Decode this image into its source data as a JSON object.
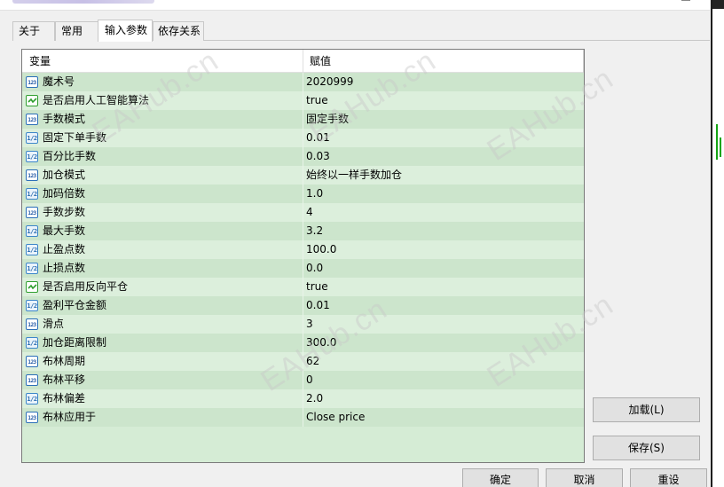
{
  "tabs": [
    {
      "label": "关于",
      "active": false
    },
    {
      "label": "常用",
      "active": false
    },
    {
      "label": "输入参数",
      "active": true
    },
    {
      "label": "依存关系",
      "active": false
    }
  ],
  "grid": {
    "headers": {
      "variable": "变量",
      "value": "赋值"
    },
    "rows": [
      {
        "type": "int",
        "name": "魔术号",
        "value": "2020999"
      },
      {
        "type": "bool",
        "name": "是否启用人工智能算法",
        "value": "true"
      },
      {
        "type": "int",
        "name": "手数模式",
        "value": "固定手数"
      },
      {
        "type": "double",
        "name": "固定下单手数",
        "value": "0.01"
      },
      {
        "type": "double",
        "name": "百分比手数",
        "value": "0.03"
      },
      {
        "type": "int",
        "name": "加仓模式",
        "value": "始终以一样手数加仓"
      },
      {
        "type": "double",
        "name": "加码倍数",
        "value": "1.0"
      },
      {
        "type": "int",
        "name": "手数步数",
        "value": "4"
      },
      {
        "type": "double",
        "name": "最大手数",
        "value": "3.2"
      },
      {
        "type": "double",
        "name": "止盈点数",
        "value": "100.0"
      },
      {
        "type": "double",
        "name": "止损点数",
        "value": "0.0"
      },
      {
        "type": "bool",
        "name": "是否启用反向平仓",
        "value": "true"
      },
      {
        "type": "double",
        "name": "盈利平仓金额",
        "value": "0.01"
      },
      {
        "type": "int",
        "name": "滑点",
        "value": "3"
      },
      {
        "type": "double",
        "name": "加仓距离限制",
        "value": "300.0"
      },
      {
        "type": "int",
        "name": "布林周期",
        "value": "62"
      },
      {
        "type": "int",
        "name": "布林平移",
        "value": "0"
      },
      {
        "type": "double",
        "name": "布林偏差",
        "value": "2.0"
      },
      {
        "type": "int",
        "name": "布林应用于",
        "value": "Close price"
      }
    ]
  },
  "icons": {
    "int": "123",
    "double": "1/2",
    "bool": "checkmark-icon"
  },
  "watermarks": [
    "EAHub.cn",
    "EAHub.cn",
    "EAHub.cn",
    "EAHub.cn"
  ],
  "buttons": {
    "load": "加载(L)",
    "save": "保存(S)",
    "ok": "确定",
    "cancel": "取消",
    "reset": "重设"
  },
  "colors": {
    "row_odd": "#cce5cc",
    "row_even": "#dcefdc",
    "bool_icon": "#2f9e2f",
    "int_icon": "#2b6fb8"
  }
}
